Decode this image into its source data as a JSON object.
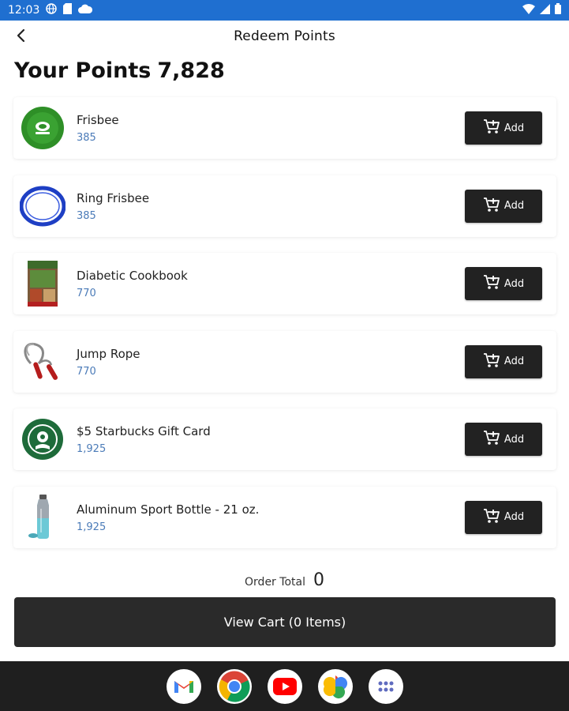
{
  "status_bar": {
    "time": "12:03",
    "left_icons": [
      "globe-icon",
      "sd-card-icon",
      "cloud-icon"
    ],
    "right_icons": [
      "wifi-icon",
      "signal-icon",
      "battery-icon"
    ]
  },
  "header": {
    "title": "Redeem Points",
    "back_icon": "back-arrow-icon"
  },
  "points": {
    "label": "Your Points",
    "value": "7,828"
  },
  "rewards": [
    {
      "name": "Frisbee",
      "cost": "385",
      "thumb": "frisbee-green",
      "add_label": "Add"
    },
    {
      "name": "Ring Frisbee",
      "cost": "385",
      "thumb": "ring-frisbee-blue",
      "add_label": "Add"
    },
    {
      "name": "Diabetic Cookbook",
      "cost": "770",
      "thumb": "cookbook",
      "add_label": "Add"
    },
    {
      "name": "Jump Rope",
      "cost": "770",
      "thumb": "jump-rope",
      "add_label": "Add"
    },
    {
      "name": "$5 Starbucks Gift Card",
      "cost": "1,925",
      "thumb": "starbucks",
      "add_label": "Add"
    },
    {
      "name": "Aluminum Sport Bottle - 21 oz.",
      "cost": "1,925",
      "thumb": "sport-bottle",
      "add_label": "Add"
    }
  ],
  "order_total": {
    "label": "Order Total",
    "value": "0"
  },
  "cart_button": {
    "label": "View Cart (0 Items)"
  },
  "dock": {
    "apps": [
      "gmail-icon",
      "chrome-icon",
      "youtube-icon",
      "photos-icon",
      "app-drawer-icon"
    ]
  },
  "colors": {
    "status_bar": "#1f6fd0",
    "button_dark": "#222222",
    "cost_text": "#4b7bb8",
    "dock_bg": "#1f1f1f"
  }
}
